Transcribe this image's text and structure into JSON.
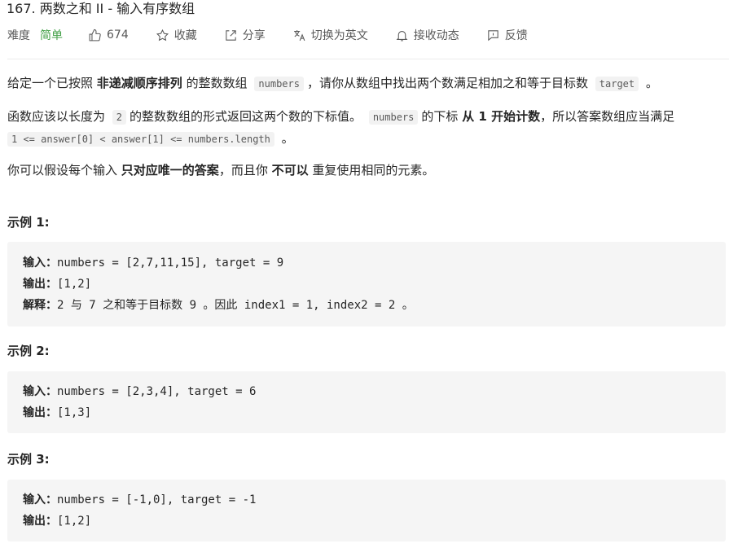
{
  "problem": {
    "title": "167. 两数之和 II - 输入有序数组"
  },
  "toolbar": {
    "difficulty_label": "难度",
    "difficulty_value": "简单",
    "likes": "674",
    "favorite": "收藏",
    "share": "分享",
    "translate": "切换为英文",
    "subscribe": "接收动态",
    "feedback": "反馈"
  },
  "description": {
    "p1_a": "给定一个已按照",
    "p1_b": "非递减顺序排列",
    "p1_c": "的整数数组",
    "p1_code1": "numbers",
    "p1_d": "，请你从数组中找出两个数满足相加之和等于目标数",
    "p1_code2": "target",
    "p1_e": "。",
    "p2_a": "函数应该以长度为",
    "p2_code1": "2",
    "p2_b": "的整数数组的形式返回这两个数的下标值。",
    "p2_code2": "numbers",
    "p2_c": "的下标",
    "p2_d": "从 1 开始计数",
    "p2_e": "，所以答案数组应当满足",
    "p2_code3": "1 <= answer[0] < answer[1] <= numbers.length",
    "p2_f": "。",
    "p3_a": "你可以假设每个输入",
    "p3_b": "只对应唯一的答案",
    "p3_c": "，而且你",
    "p3_d": "不可以",
    "p3_e": "重复使用相同的元素。"
  },
  "examples": [
    {
      "title": "示例 1:",
      "input_label": "输入：",
      "input": "numbers = [2,7,11,15], target = 9",
      "output_label": "输出：",
      "output": "[1,2]",
      "explain_label": "解释：",
      "explain": "2 与 7 之和等于目标数 9 。因此 index1 = 1, index2 = 2 。"
    },
    {
      "title": "示例 2:",
      "input_label": "输入：",
      "input": "numbers = [2,3,4], target = 6",
      "output_label": "输出：",
      "output": "[1,3]"
    },
    {
      "title": "示例 3:",
      "input_label": "输入：",
      "input": "numbers = [-1,0], target = -1",
      "output_label": "输出：",
      "output": "[1,2]"
    }
  ],
  "colors": {
    "easy": "#43a047",
    "code_bg": "#f5f5f5"
  }
}
